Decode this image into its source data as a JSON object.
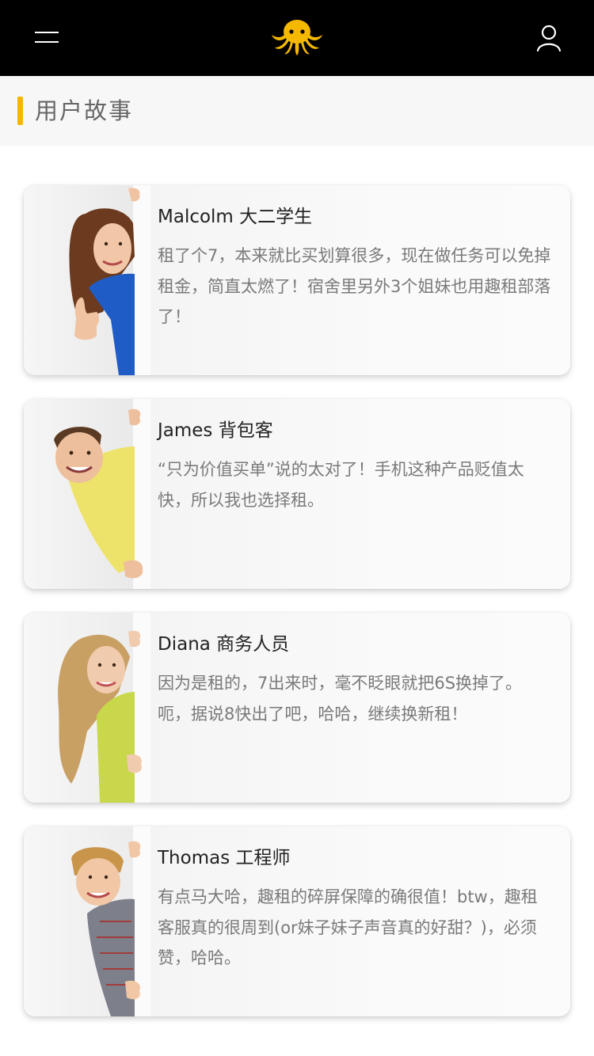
{
  "header": {
    "menu_icon": "hamburger-menu-icon",
    "logo_icon": "octopus-logo-icon",
    "user_icon": "user-profile-icon"
  },
  "section": {
    "title": "用户故事",
    "accent_color": "#f7b500"
  },
  "stories": [
    {
      "name": "Malcolm 大二学生",
      "text": "租了个7，本来就比买划算很多，现在做任务可以免掉租金，简直太燃了！宿舍里另外3个姐妹也用趣租部落了！",
      "avatar": "girl-thumbs-up-photo"
    },
    {
      "name": "James 背包客",
      "text": "“只为价值买单”说的太对了！手机这种产品贬值太快，所以我也选择租。",
      "avatar": "young-man-yellow-hoodie-photo"
    },
    {
      "name": "Diana 商务人员",
      "text": "因为是租的，7出来时，毫不眨眼就把6S换掉了。呃，据说8快出了吧，哈哈，继续换新租！",
      "avatar": "curly-blonde-woman-photo"
    },
    {
      "name": "Thomas 工程师",
      "text": "有点马大哈，趣租的碎屏保障的确很值！btw，趣租客服真的很周到(or妹子妹子声音真的好甜？)，必须赞，哈哈。",
      "avatar": "blond-boy-plaid-shirt-photo"
    }
  ]
}
